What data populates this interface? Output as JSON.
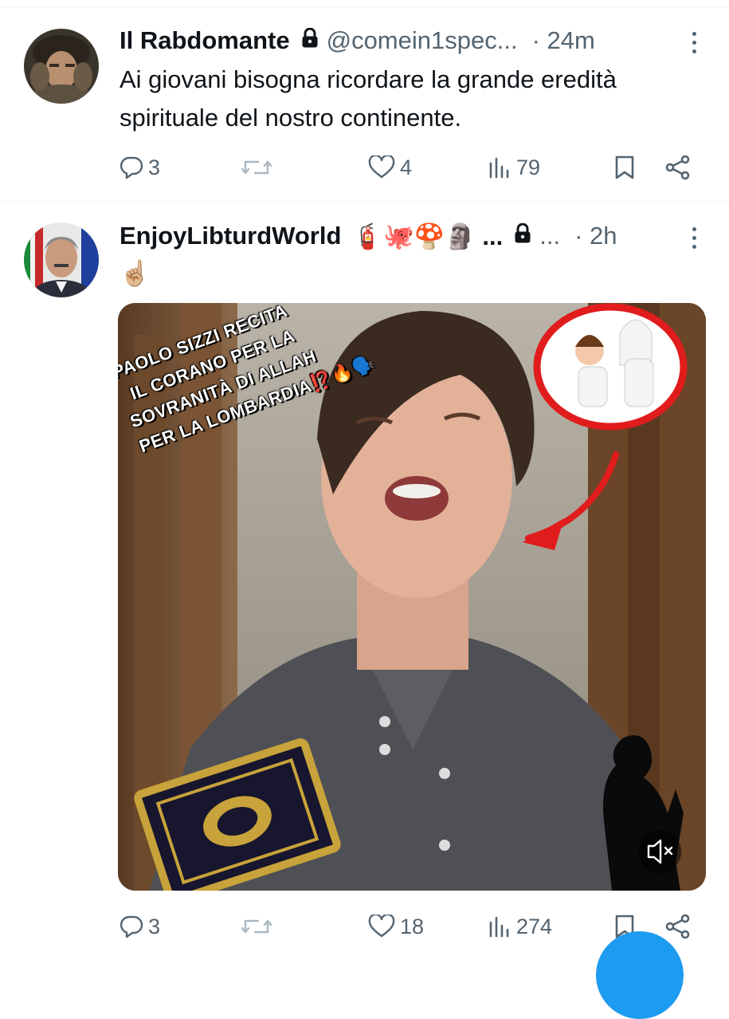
{
  "tweets": [
    {
      "name": "Il Rabdomante",
      "handle": "@comein1spec...",
      "time": "· 24m",
      "text": "Ai giovani bisogna ricordare la grande eredità spirituale del nostro continente.",
      "replies": "3",
      "retweets": "",
      "likes": "4",
      "views": "79"
    },
    {
      "name": "EnjoyLibturdWorld",
      "name_emoji": "🧯🐙🍄🗿 ...",
      "handle": "...",
      "time": "· 2h",
      "text": "☝🏼",
      "media_caption": [
        "PAOLO SIZZI RECITA",
        "IL CORANO PER LA",
        "SOVRANITÀ DI ALLAH",
        "PER LA LOMBARDIA⁉️🔥🗣️"
      ],
      "replies": "3",
      "retweets": "",
      "likes": "18",
      "views": "274"
    }
  ],
  "icons": {
    "reply": "reply-icon",
    "retweet": "retweet-icon",
    "like": "like-icon",
    "views": "views-icon",
    "bookmark": "bookmark-icon",
    "share": "share-icon",
    "mute": "mute-icon"
  },
  "colors": {
    "text": "#0f1419",
    "secondary": "#536471",
    "accent": "#1d9bf0",
    "divider": "#eff3f4",
    "retweet_icon": "#aab8c2"
  }
}
